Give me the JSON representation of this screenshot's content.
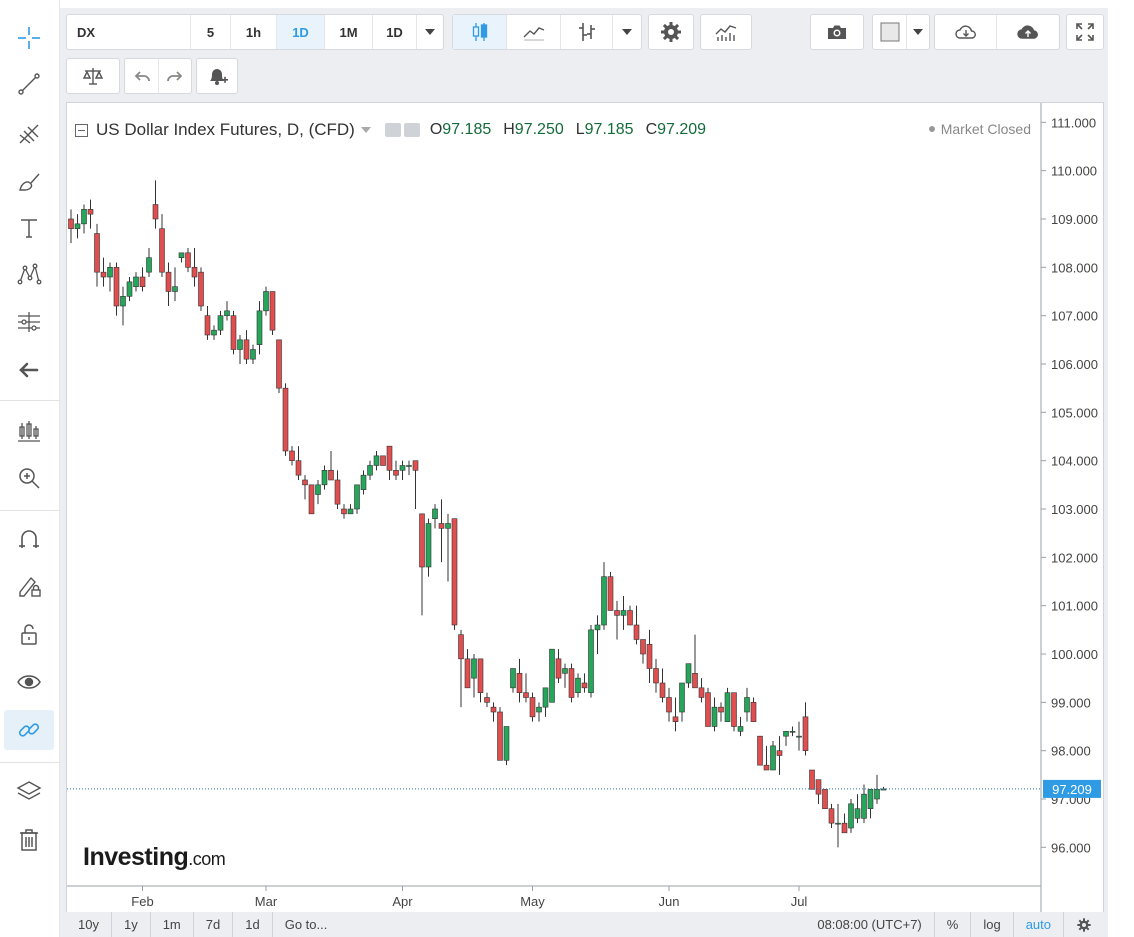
{
  "symbol": "DX",
  "toolbar": {
    "intervals": [
      "5",
      "1h",
      "1D",
      "1M"
    ],
    "interval_selected": "1D",
    "interval_dropdown": "1D"
  },
  "legend": {
    "title": "US Dollar Index Futures, D, (CFD)",
    "o_label": "O",
    "o_value": "97.185",
    "h_label": "H",
    "h_value": "97.250",
    "l_label": "L",
    "l_value": "97.185",
    "c_label": "C",
    "c_value": "97.209"
  },
  "market_status": "Market Closed",
  "logo": {
    "main": "Investing",
    "suffix": ".com"
  },
  "bottombar": {
    "ranges": [
      "10y",
      "1y",
      "1m",
      "7d",
      "1d"
    ],
    "goto": "Go to...",
    "time": "08:08:00 (UTC+7)",
    "percent": "%",
    "log": "log",
    "auto": "auto"
  },
  "colors": {
    "up": "#26a65b",
    "down": "#e04f4f",
    "accent": "#2e9be4",
    "last_price_bg": "#2e9be4"
  },
  "icons": {
    "sidebar": [
      "crosshair-icon",
      "trend-line-icon",
      "pitchfork-icon",
      "brush-icon",
      "text-icon",
      "pattern-icon",
      "measure-icon",
      "back-arrow-icon",
      "chart-pattern-icon",
      "zoom-in-icon",
      "magnet-icon",
      "lock-drawing-icon",
      "unlock-icon",
      "eye-icon",
      "link-icon",
      "layers-icon",
      "trash-icon"
    ],
    "toolbar": [
      "candles-icon",
      "line-chart-icon",
      "bars-icon",
      "gear-icon",
      "indicators-icon",
      "camera-icon",
      "color-box-icon",
      "cloud-download-icon",
      "cloud-upload-icon",
      "fullscreen-icon",
      "balance-icon",
      "undo-icon",
      "redo-icon",
      "alert-bell-icon"
    ]
  },
  "chart_data": {
    "type": "candlestick",
    "title": "US Dollar Index Futures, D, (CFD)",
    "yticks": [
      "111.000",
      "110.000",
      "109.000",
      "108.000",
      "107.000",
      "106.000",
      "105.000",
      "104.000",
      "103.000",
      "102.000",
      "101.000",
      "100.000",
      "99.000",
      "98.000",
      "97.000",
      "96.000"
    ],
    "ylim": [
      95.2,
      111.4
    ],
    "xticks": [
      {
        "label": "Feb",
        "index": 11
      },
      {
        "label": "Mar",
        "index": 30
      },
      {
        "label": "Apr",
        "index": 51
      },
      {
        "label": "May",
        "index": 71
      },
      {
        "label": "Jun",
        "index": 92
      },
      {
        "label": "Jul",
        "index": 112
      }
    ],
    "last_price": "97.209",
    "last_price_value": 97.209,
    "candles": [
      [
        109.0,
        109.2,
        108.5,
        108.8
      ],
      [
        108.8,
        109.1,
        108.6,
        108.9
      ],
      [
        108.9,
        109.3,
        108.7,
        109.2
      ],
      [
        109.2,
        109.4,
        108.8,
        109.1
      ],
      [
        108.7,
        108.9,
        107.6,
        107.9
      ],
      [
        107.9,
        108.2,
        107.6,
        107.8
      ],
      [
        107.8,
        108.1,
        107.5,
        108.0
      ],
      [
        108.0,
        108.1,
        107.0,
        107.2
      ],
      [
        107.2,
        107.6,
        106.8,
        107.4
      ],
      [
        107.4,
        107.8,
        107.3,
        107.7
      ],
      [
        107.6,
        107.9,
        107.5,
        107.8
      ],
      [
        107.8,
        108.0,
        107.5,
        107.6
      ],
      [
        107.9,
        108.4,
        107.8,
        108.2
      ],
      [
        109.3,
        109.8,
        108.8,
        109.0
      ],
      [
        108.8,
        109.1,
        107.8,
        107.9
      ],
      [
        107.9,
        108.1,
        107.2,
        107.5
      ],
      [
        107.5,
        108.0,
        107.3,
        107.6
      ],
      [
        108.2,
        108.3,
        108.1,
        108.3
      ],
      [
        108.3,
        108.4,
        107.9,
        108.0
      ],
      [
        108.0,
        108.4,
        107.6,
        107.8
      ],
      [
        107.9,
        108.0,
        107.1,
        107.2
      ],
      [
        107.0,
        107.2,
        106.5,
        106.6
      ],
      [
        106.6,
        106.8,
        106.5,
        106.7
      ],
      [
        106.7,
        107.1,
        106.6,
        107.0
      ],
      [
        107.0,
        107.3,
        106.9,
        107.1
      ],
      [
        107.0,
        107.1,
        106.2,
        106.3
      ],
      [
        106.3,
        106.6,
        106.0,
        106.5
      ],
      [
        106.5,
        106.7,
        106.0,
        106.1
      ],
      [
        106.1,
        106.4,
        106.0,
        106.3
      ],
      [
        106.4,
        107.3,
        106.2,
        107.1
      ],
      [
        107.1,
        107.6,
        107.0,
        107.5
      ],
      [
        107.5,
        107.5,
        106.6,
        106.7
      ],
      [
        106.5,
        106.5,
        105.4,
        105.5
      ],
      [
        105.5,
        105.6,
        104.1,
        104.2
      ],
      [
        104.2,
        104.3,
        103.9,
        104.0
      ],
      [
        104.0,
        104.3,
        103.6,
        103.7
      ],
      [
        103.6,
        103.7,
        103.2,
        103.5
      ],
      [
        103.5,
        103.5,
        102.9,
        102.9
      ],
      [
        103.3,
        103.6,
        103.1,
        103.5
      ],
      [
        103.5,
        103.9,
        103.4,
        103.8
      ],
      [
        103.8,
        104.2,
        103.7,
        103.6
      ],
      [
        103.6,
        103.8,
        103.0,
        103.1
      ],
      [
        103.0,
        103.1,
        102.8,
        102.9
      ],
      [
        102.9,
        103.1,
        102.9,
        103.0
      ],
      [
        103.0,
        103.5,
        102.9,
        103.5
      ],
      [
        103.4,
        103.8,
        103.3,
        103.7
      ],
      [
        103.7,
        104.0,
        103.6,
        103.9
      ],
      [
        103.9,
        104.2,
        103.8,
        104.1
      ],
      [
        104.1,
        104.1,
        103.9,
        103.9
      ],
      [
        104.3,
        104.3,
        103.6,
        103.8
      ],
      [
        103.8,
        104.0,
        103.6,
        103.7
      ],
      [
        103.8,
        104.0,
        103.6,
        103.9
      ],
      [
        103.9,
        104.0,
        103.7,
        103.9
      ],
      [
        104.0,
        104.0,
        103.0,
        103.8
      ],
      [
        102.9,
        102.9,
        100.8,
        101.8
      ],
      [
        101.8,
        102.8,
        101.6,
        102.7
      ],
      [
        102.8,
        103.1,
        102.6,
        103.0
      ],
      [
        102.7,
        103.2,
        101.9,
        102.6
      ],
      [
        102.6,
        102.9,
        101.5,
        102.7
      ],
      [
        102.8,
        102.8,
        100.5,
        100.6
      ],
      [
        100.4,
        100.5,
        98.9,
        99.9
      ],
      [
        99.9,
        100.1,
        99.4,
        99.3
      ],
      [
        99.5,
        100.0,
        99.1,
        99.9
      ],
      [
        99.9,
        99.9,
        99.0,
        99.2
      ],
      [
        99.1,
        99.2,
        98.9,
        99.0
      ],
      [
        98.9,
        99.0,
        98.6,
        98.8
      ],
      [
        98.8,
        98.9,
        97.8,
        97.8
      ],
      [
        97.8,
        98.5,
        97.7,
        98.5
      ],
      [
        99.3,
        99.7,
        99.2,
        99.7
      ],
      [
        99.6,
        99.9,
        99.0,
        99.2
      ],
      [
        99.2,
        99.6,
        99.0,
        99.1
      ],
      [
        99.1,
        99.2,
        98.6,
        98.7
      ],
      [
        98.8,
        99.0,
        98.6,
        98.9
      ],
      [
        98.9,
        99.3,
        98.7,
        99.3
      ],
      [
        99.0,
        100.1,
        99.0,
        100.1
      ],
      [
        99.9,
        100.1,
        99.4,
        99.5
      ],
      [
        99.6,
        99.8,
        99.3,
        99.7
      ],
      [
        99.7,
        99.8,
        99.0,
        99.1
      ],
      [
        99.2,
        99.6,
        99.1,
        99.5
      ],
      [
        99.4,
        99.6,
        99.2,
        99.3
      ],
      [
        99.2,
        100.6,
        99.1,
        100.5
      ],
      [
        100.5,
        100.8,
        100.0,
        100.6
      ],
      [
        100.6,
        101.9,
        100.5,
        101.6
      ],
      [
        101.6,
        101.7,
        100.9,
        100.9
      ],
      [
        100.9,
        101.1,
        100.3,
        100.8
      ],
      [
        100.8,
        101.2,
        100.5,
        100.9
      ],
      [
        100.9,
        101.0,
        100.6,
        100.6
      ],
      [
        100.6,
        101.0,
        100.2,
        100.3
      ],
      [
        100.3,
        100.3,
        99.8,
        100.0
      ],
      [
        100.2,
        100.5,
        99.4,
        99.7
      ],
      [
        99.7,
        99.9,
        99.2,
        99.4
      ],
      [
        99.4,
        99.7,
        99.0,
        99.1
      ],
      [
        99.1,
        99.3,
        98.6,
        98.8
      ],
      [
        98.7,
        99.1,
        98.4,
        98.6
      ],
      [
        98.8,
        99.4,
        98.6,
        99.4
      ],
      [
        99.4,
        99.8,
        99.3,
        99.8
      ],
      [
        99.6,
        100.4,
        99.5,
        99.3
      ],
      [
        99.3,
        99.5,
        99.0,
        99.1
      ],
      [
        99.2,
        99.3,
        98.5,
        98.5
      ],
      [
        98.5,
        99.1,
        98.4,
        98.9
      ],
      [
        98.9,
        99.0,
        98.6,
        98.8
      ],
      [
        98.6,
        99.3,
        98.6,
        99.2
      ],
      [
        99.2,
        99.2,
        98.4,
        98.5
      ],
      [
        98.4,
        98.7,
        98.3,
        98.5
      ],
      [
        98.8,
        99.3,
        98.6,
        99.1
      ],
      [
        99.0,
        99.1,
        98.6,
        98.6
      ],
      [
        98.3,
        98.3,
        97.7,
        97.7
      ],
      [
        97.7,
        98.1,
        97.6,
        97.6
      ],
      [
        97.6,
        98.2,
        97.6,
        98.1
      ],
      [
        98.0,
        98.3,
        97.5,
        97.9
      ],
      [
        98.3,
        98.4,
        98.1,
        98.4
      ],
      [
        98.4,
        98.5,
        98.3,
        98.4
      ],
      [
        98.3,
        98.6,
        98.0,
        98.3
      ],
      [
        98.7,
        99.0,
        97.9,
        98.0
      ],
      [
        97.6,
        97.6,
        97.3,
        97.2
      ],
      [
        97.4,
        97.4,
        96.9,
        97.1
      ],
      [
        97.2,
        97.2,
        96.8,
        96.8
      ],
      [
        96.8,
        96.9,
        96.4,
        96.5
      ],
      [
        96.5,
        96.9,
        96.0,
        96.5
      ],
      [
        96.5,
        96.7,
        96.3,
        96.3
      ],
      [
        96.4,
        97.0,
        96.3,
        96.9
      ],
      [
        96.6,
        97.1,
        96.5,
        96.8
      ],
      [
        96.6,
        97.3,
        96.5,
        97.1
      ],
      [
        96.8,
        97.2,
        96.6,
        97.2
      ],
      [
        97.0,
        97.5,
        96.9,
        97.2
      ],
      [
        97.185,
        97.25,
        97.185,
        97.209
      ]
    ]
  }
}
